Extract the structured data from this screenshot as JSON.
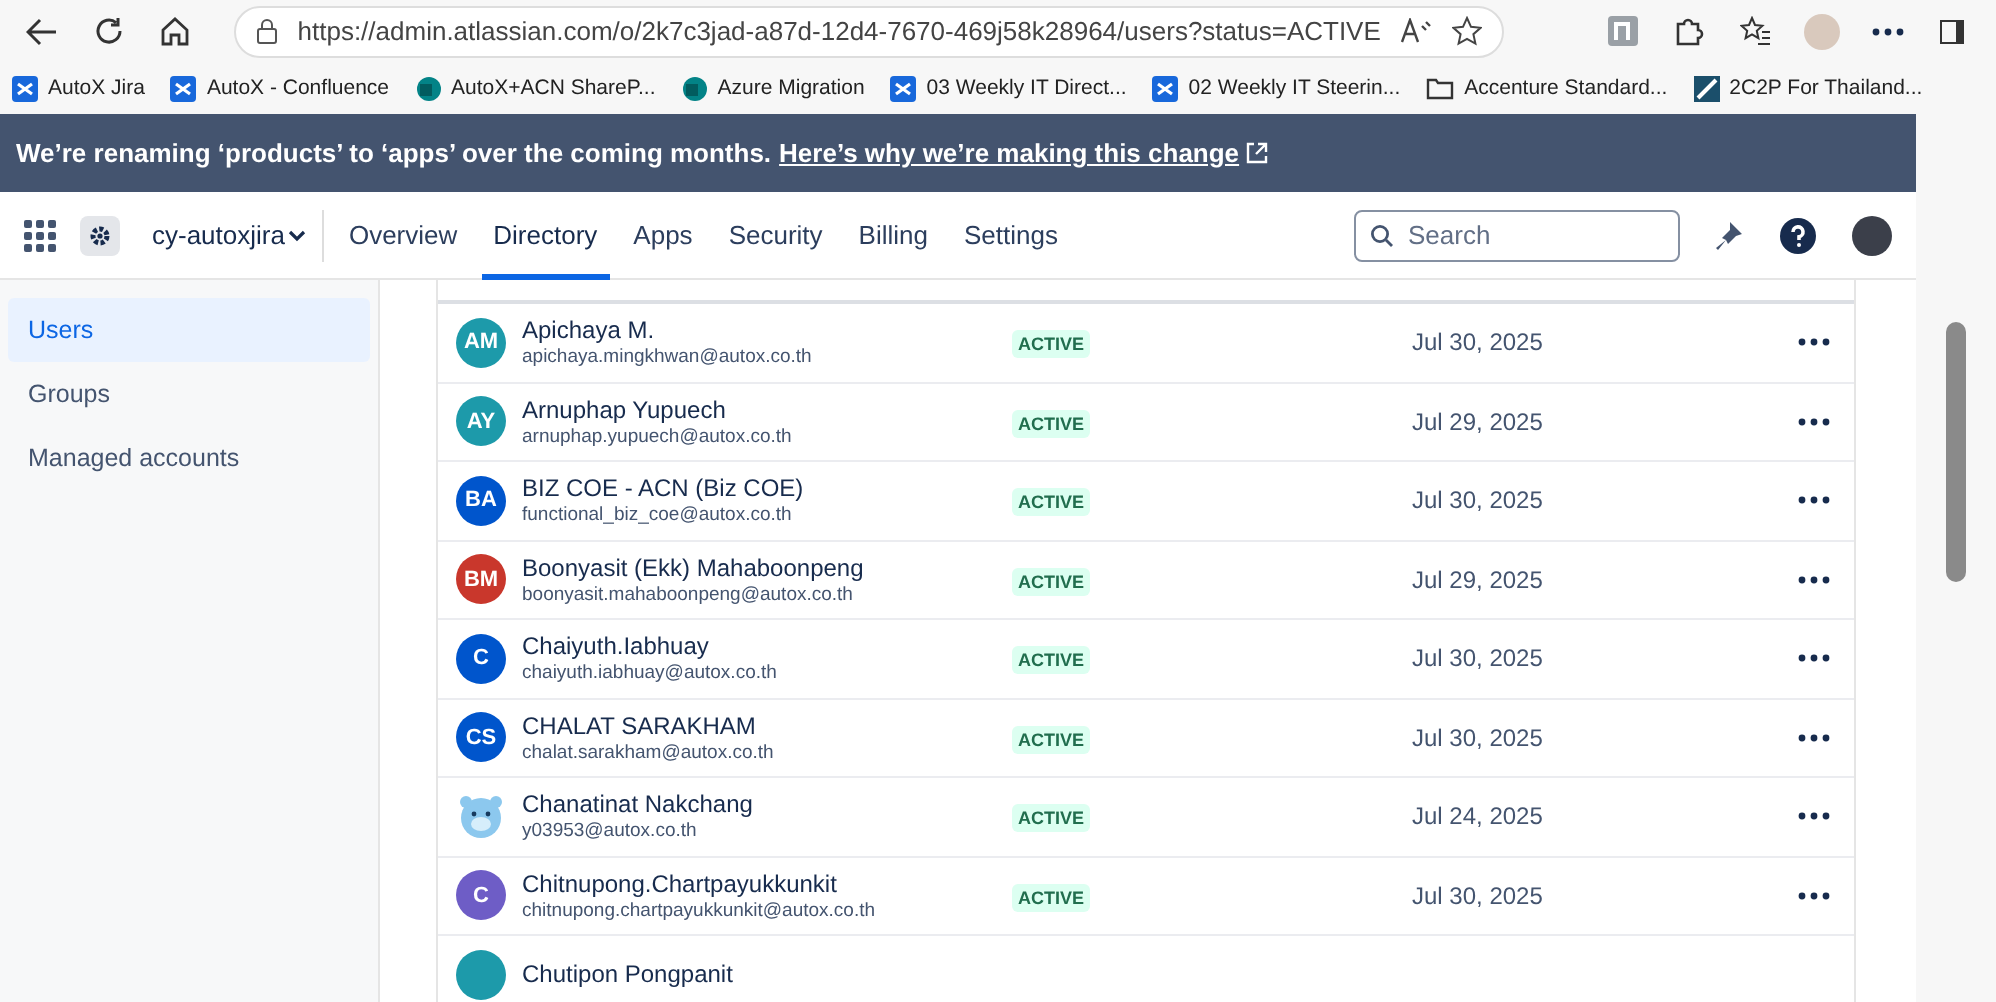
{
  "browser": {
    "url": "https://admin.atlassian.com/o/2k7c3jad-a87d-12d4-7670-469j58k28964/users?status=ACTIVE",
    "bookmarks": [
      {
        "label": "AutoX Jira",
        "kind": "app"
      },
      {
        "label": "AutoX - Confluence",
        "kind": "app"
      },
      {
        "label": "AutoX+ACN ShareP...",
        "kind": "sharepoint"
      },
      {
        "label": "Azure Migration",
        "kind": "sharepoint"
      },
      {
        "label": "03 Weekly IT Direct...",
        "kind": "app"
      },
      {
        "label": "02 Weekly IT Steerin...",
        "kind": "app"
      },
      {
        "label": "Accenture Standard...",
        "kind": "folder"
      },
      {
        "label": "2C2P For Thailand...",
        "kind": "site"
      }
    ]
  },
  "banner": {
    "text": "We’re renaming ‘products’ to ‘apps’ over the coming months.",
    "link": "Here’s why we’re making this change"
  },
  "nav": {
    "org": "cy-autoxjira",
    "tabs": [
      {
        "label": "Overview",
        "selected": false
      },
      {
        "label": "Directory",
        "selected": true
      },
      {
        "label": "Apps",
        "selected": false
      },
      {
        "label": "Security",
        "selected": false
      },
      {
        "label": "Billing",
        "selected": false
      },
      {
        "label": "Settings",
        "selected": false
      }
    ],
    "search": {
      "placeholder": "Search"
    }
  },
  "sidebar": {
    "items": [
      {
        "label": "Users",
        "selected": true
      },
      {
        "label": "Groups",
        "selected": false
      },
      {
        "label": "Managed accounts",
        "selected": false
      }
    ]
  },
  "users": [
    {
      "name": "Apichaya M.",
      "email": "apichaya.mingkhwan@autox.co.th",
      "kind": "initials",
      "initials": "AM",
      "color": "#1d9aaa",
      "status": "ACTIVE",
      "date": "Jul 30, 2025"
    },
    {
      "name": "Arnuphap Yupuech",
      "email": "arnuphap.yupuech@autox.co.th",
      "kind": "initials",
      "initials": "AY",
      "color": "#1d9aaa",
      "status": "ACTIVE",
      "date": "Jul 29, 2025"
    },
    {
      "name": "BIZ COE - ACN (Biz COE)",
      "email": "functional_biz_coe@autox.co.th",
      "kind": "initials",
      "initials": "BA",
      "color": "#0055cc",
      "status": "ACTIVE",
      "date": "Jul 30, 2025"
    },
    {
      "name": "Boonyasit (Ekk) Mahaboonpeng",
      "email": "boonyasit.mahaboonpeng@autox.co.th",
      "kind": "initials",
      "initials": "BM",
      "color": "#c9372c",
      "status": "ACTIVE",
      "date": "Jul 29, 2025"
    },
    {
      "name": "Chaiyuth.Iabhuay",
      "email": "chaiyuth.iabhuay@autox.co.th",
      "kind": "initials",
      "initials": "C",
      "color": "#0055cc",
      "status": "ACTIVE",
      "date": "Jul 30, 2025"
    },
    {
      "name": "CHALAT SARAKHAM",
      "email": "chalat.sarakham@autox.co.th",
      "kind": "initials",
      "initials": "CS",
      "color": "#0055cc",
      "status": "ACTIVE",
      "date": "Jul 30, 2025"
    },
    {
      "name": "Chanatinat Nakchang",
      "email": "y03953@autox.co.th",
      "kind": "picture",
      "status": "ACTIVE",
      "date": "Jul 24, 2025"
    },
    {
      "name": "Chitnupong.Chartpayukkunkit",
      "email": "chitnupong.chartpayukkunkit@autox.co.th",
      "kind": "initials",
      "initials": "C",
      "color": "#6e5dc6",
      "status": "ACTIVE",
      "date": "Jul 30, 2025"
    },
    {
      "name": "Chutipon Pongpanit",
      "kind": "partial",
      "color": "#1d9aaa"
    }
  ]
}
